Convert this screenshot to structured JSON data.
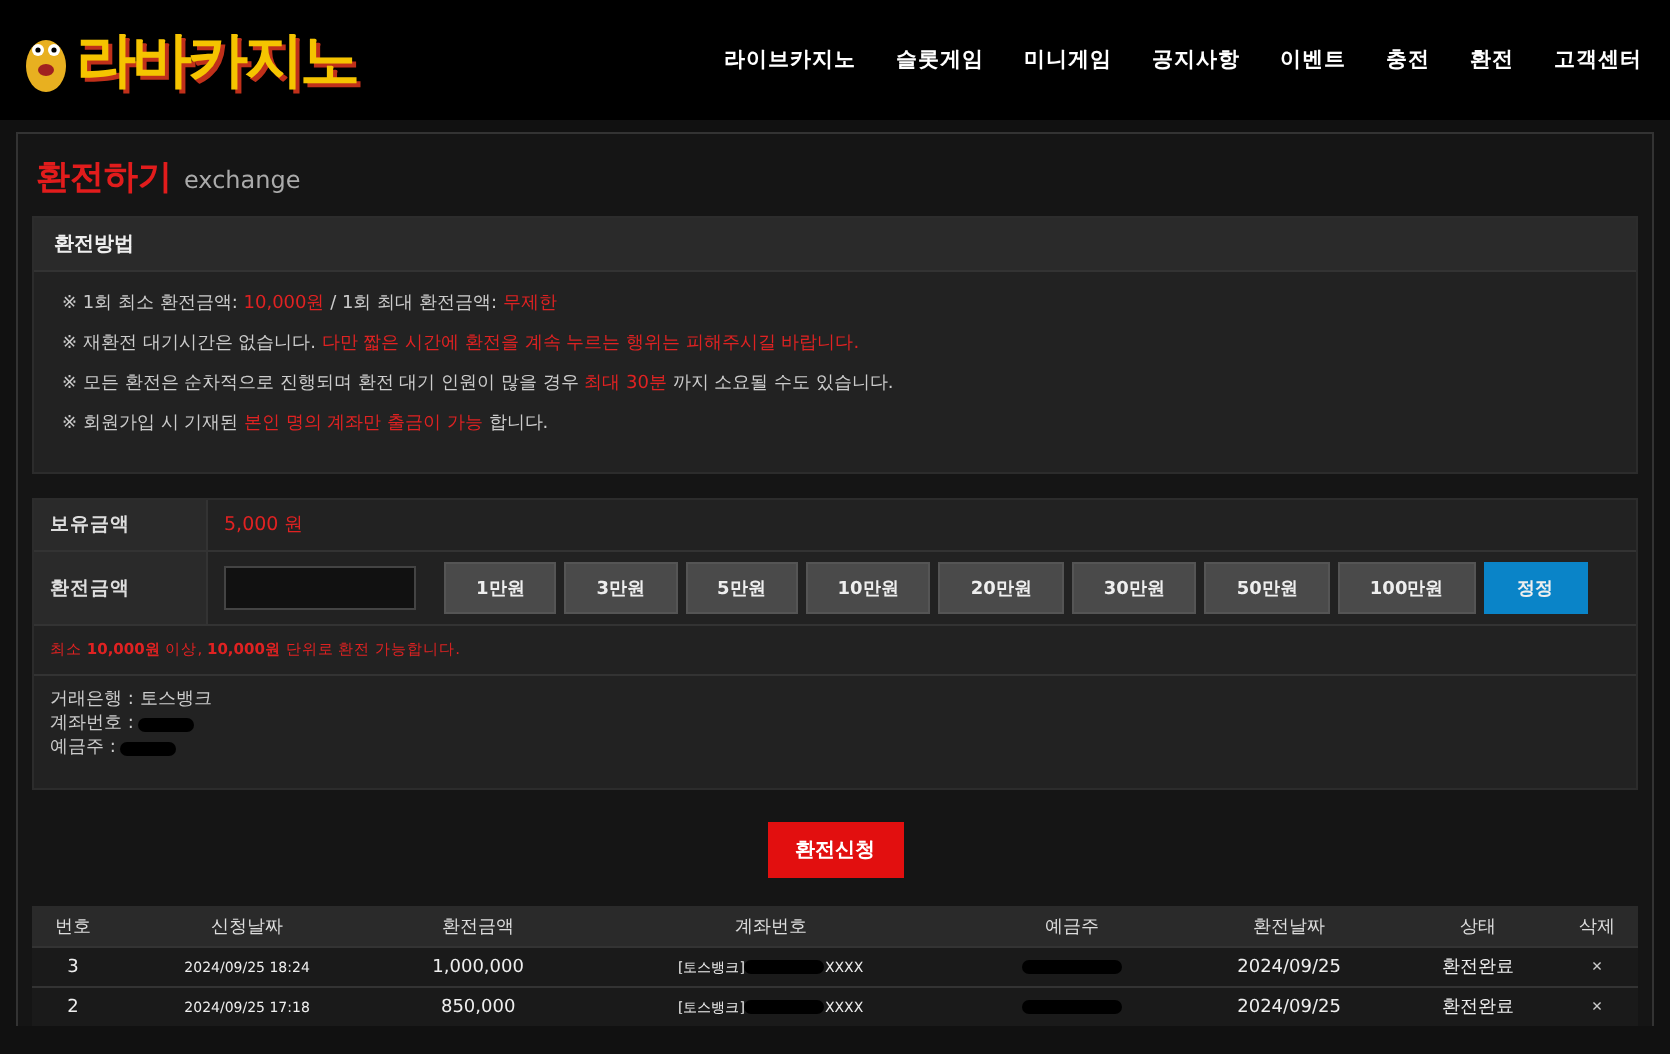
{
  "logo": {
    "text": "라바카지노"
  },
  "nav": [
    "라이브카지노",
    "슬롯게임",
    "미니게임",
    "공지사항",
    "이벤트",
    "충전",
    "환전",
    "고객센터"
  ],
  "page_title": {
    "title": "환전하기",
    "subtitle": "exchange"
  },
  "method": {
    "title": "환전방법",
    "notices": [
      [
        {
          "text": "※ 1회 최소 환전금액: ",
          "highlight": false
        },
        {
          "text": "10,000원",
          "highlight": true
        },
        {
          "text": " / 1회 최대 환전금액: ",
          "highlight": false
        },
        {
          "text": "무제한",
          "highlight": true
        }
      ],
      [
        {
          "text": "※ 재환전 대기시간은 없습니다. ",
          "highlight": false
        },
        {
          "text": "다만 짧은 시간에 환전을 계속 누르는 행위는 피해주시길 바랍니다.",
          "highlight": true
        }
      ],
      [
        {
          "text": "※ 모든 환전은 순차적으로 진행되며 환전 대기 인원이 많을 경우 ",
          "highlight": false
        },
        {
          "text": "최대 30분",
          "highlight": true
        },
        {
          "text": " 까지 소요될 수도 있습니다.",
          "highlight": false
        }
      ],
      [
        {
          "text": "※ 회원가입 시 기재된 ",
          "highlight": false
        },
        {
          "text": "본인 명의 계좌만 출금이 가능",
          "highlight": true
        },
        {
          "text": " 합니다.",
          "highlight": false
        }
      ]
    ]
  },
  "form": {
    "balance_label": "보유금액",
    "balance": "5,000 원",
    "amount_label": "환전금액",
    "amount_buttons": [
      {
        "label": "1만원",
        "kind": "add"
      },
      {
        "label": "3만원",
        "kind": "add"
      },
      {
        "label": "5만원",
        "kind": "add"
      },
      {
        "label": "10만원",
        "kind": "add"
      },
      {
        "label": "20만원",
        "kind": "add"
      },
      {
        "label": "30만원",
        "kind": "add"
      },
      {
        "label": "50만원",
        "kind": "add"
      },
      {
        "label": "100만원",
        "kind": "add"
      },
      {
        "label": "정정",
        "kind": "reset"
      }
    ],
    "rule": "최소 **10,000원** 이상, **10,000원**  단위로 환전 가능합니다.",
    "bank_lines": [
      {
        "text": "거래은행 : 토스뱅크",
        "redacted": false
      },
      {
        "text": "계좌번호 :",
        "redacted": true
      },
      {
        "text": "예금주 :",
        "redacted": true
      }
    ]
  },
  "submit": "환전신청",
  "table": {
    "columns": [
      "번호",
      "신청날짜",
      "환전금액",
      "계좌번호",
      "예금주",
      "환전날짜",
      "상태",
      "삭제"
    ],
    "rows": [
      {
        "no": "3",
        "requested": "2024/09/25 18:24",
        "amount": "1,000,000",
        "bank": "[토스뱅크]",
        "account_tail": "XXXX",
        "date": "2024/09/25",
        "status": "환전완료",
        "delete": "×"
      },
      {
        "no": "2",
        "requested": "2024/09/25 17:18",
        "amount": "850,000",
        "bank": "[토스뱅크]",
        "account_tail": "XXXX",
        "date": "2024/09/25",
        "status": "환전완료",
        "delete": "×"
      }
    ]
  }
}
